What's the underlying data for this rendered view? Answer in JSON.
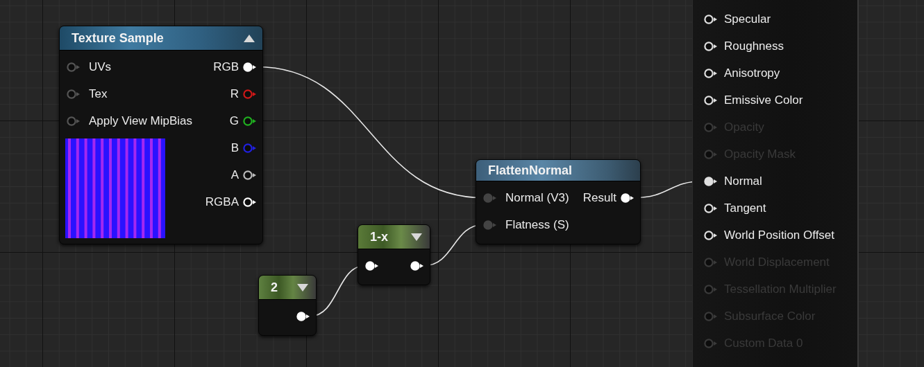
{
  "nodes": [
    {
      "kind": "texture",
      "title": "Texture Sample",
      "expanded": true,
      "inputs": [
        {
          "label": "UVs",
          "connected": false,
          "color": "#555555"
        },
        {
          "label": "Tex",
          "connected": false,
          "color": "#555555"
        },
        {
          "label": "Apply View MipBias",
          "connected": false,
          "color": "#555555"
        }
      ],
      "outputs": [
        {
          "label": "RGB",
          "connected": true,
          "color": "#ffffff"
        },
        {
          "label": "R",
          "connected": false,
          "color": "#d01818"
        },
        {
          "label": "G",
          "connected": false,
          "color": "#20b020"
        },
        {
          "label": "B",
          "connected": false,
          "color": "#2020e0"
        },
        {
          "label": "A",
          "connected": false,
          "color": "#bbbbbb"
        },
        {
          "label": "RGBA",
          "connected": false,
          "color": "#ffffff"
        }
      ],
      "preview": {
        "kind": "picture"
      }
    },
    {
      "kind": "function",
      "title": "FlattenNormal",
      "inputs": [
        {
          "label": "Normal (V3)",
          "connected": true,
          "color": "#444444"
        },
        {
          "label": "Flatness (S)",
          "connected": true,
          "color": "#444444"
        }
      ],
      "outputs": [
        {
          "label": "Result",
          "connected": true,
          "color": "#ffffff"
        }
      ]
    },
    {
      "kind": "math",
      "title": "1-x",
      "expanded": false,
      "inputs": [
        {
          "connected": true,
          "color": "#ffffff"
        }
      ],
      "outputs": [
        {
          "connected": true,
          "color": "#ffffff"
        }
      ]
    },
    {
      "kind": "constant",
      "title": "2",
      "expanded": false,
      "outputs": [
        {
          "connected": true,
          "color": "#ffffff"
        }
      ]
    }
  ],
  "result": {
    "pins": [
      {
        "label": "Specular",
        "enabled": true,
        "connected": false
      },
      {
        "label": "Roughness",
        "enabled": true,
        "connected": false
      },
      {
        "label": "Anisotropy",
        "enabled": true,
        "connected": false
      },
      {
        "label": "Emissive Color",
        "enabled": true,
        "connected": false
      },
      {
        "label": "Opacity",
        "enabled": false,
        "connected": false
      },
      {
        "label": "Opacity Mask",
        "enabled": false,
        "connected": false
      },
      {
        "label": "Normal",
        "enabled": true,
        "connected": true
      },
      {
        "label": "Tangent",
        "enabled": true,
        "connected": false
      },
      {
        "label": "World Position Offset",
        "enabled": true,
        "connected": false
      },
      {
        "label": "World Displacement",
        "enabled": false,
        "connected": false
      },
      {
        "label": "Tessellation Multiplier",
        "enabled": false,
        "connected": false
      },
      {
        "label": "Subsurface Color",
        "enabled": false,
        "connected": false
      },
      {
        "label": "Custom Data 0",
        "enabled": false,
        "connected": false
      }
    ]
  }
}
